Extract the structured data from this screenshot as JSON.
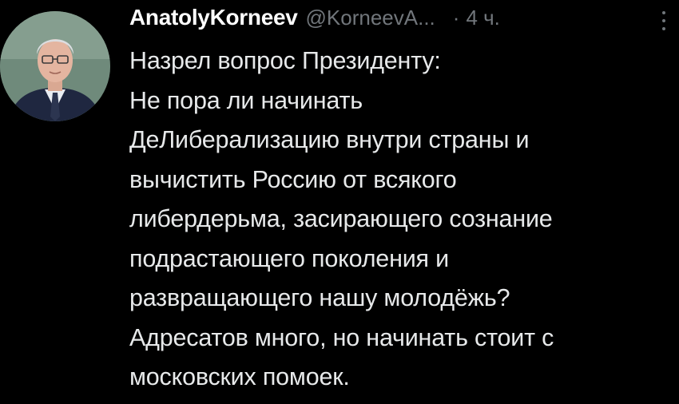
{
  "tweet": {
    "author_name": "AnatolyKorneev",
    "author_handle": "@KorneevA...",
    "separator": "·",
    "timestamp": "4 ч.",
    "more_icon": "more-vertical-icon",
    "avatar_icon": "user-avatar",
    "body_lines": [
      "Назрел вопрос Президенту:",
      "Не пора ли начинать",
      "ДеЛиберализацию внутри страны и",
      "вычистить Россию от всякого",
      "либердерьма, засирающего сознание",
      "подрастающего поколения и",
      "развращающего нашу молодёжь?",
      "Адресатов много, но начинать стоит с",
      "московских помоек."
    ]
  },
  "colors": {
    "background": "#000000",
    "primary_text": "#e7e9ea",
    "secondary_text": "#71767b",
    "name_text": "#ffffff"
  }
}
